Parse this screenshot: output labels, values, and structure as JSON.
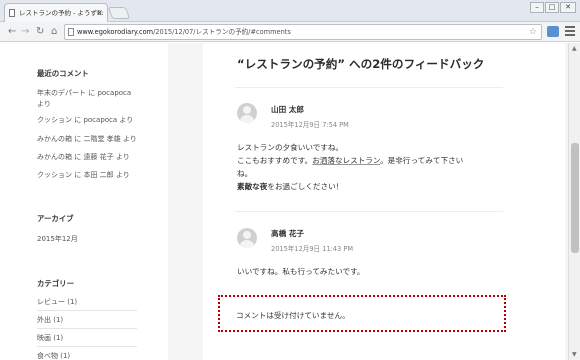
{
  "browser": {
    "tab_title": "レストランの予約 - ようずB:",
    "tab_close": "×",
    "url_domain": "www.egokorodiary.com",
    "url_path": "/2015/12/07/レストランの予約/#comments",
    "window_buttons": [
      "–",
      "□",
      "✕"
    ]
  },
  "sidebar": {
    "recent_comments_title": "最近のコメント",
    "recent_comments": [
      {
        "post": "年末のデパート",
        "sep": " に ",
        "author": "pocapoca",
        "suffix": "",
        "line2": "より"
      },
      {
        "post": "クッション",
        "sep": " に ",
        "author": "pocapoca",
        "suffix": " より"
      },
      {
        "post": "みかんの箱",
        "sep": " に ",
        "author": "二階堂 孝雄",
        "suffix": " より"
      },
      {
        "post": "みかんの箱",
        "sep": " に ",
        "author": "遠藤 花子",
        "suffix": " より"
      },
      {
        "post": "クッション",
        "sep": " に ",
        "author": "本田 二郎",
        "suffix": " より"
      }
    ],
    "archives_title": "アーカイブ",
    "archives": [
      "2015年12月"
    ],
    "categories_title": "カテゴリー",
    "categories": [
      "レビュー (1)",
      "外出 (1)",
      "映画 (1)",
      "食べ物 (1)"
    ]
  },
  "main": {
    "comments_title": "“レストランの予約” への2件のフィードバック",
    "comments": [
      {
        "author": "山田 太郎",
        "date": "2015年12月9日 7:54 PM",
        "line1": "レストランの夕食いいですね。",
        "line2_pre": "ここもおすすめです。",
        "line2_link": "お洒落なレストラン",
        "line2_post": "。是非行ってみて下さい",
        "line3": "ね。",
        "line4_bold": "素敵な夜",
        "line4_rest": "をお過ごしください！"
      },
      {
        "author": "高橋 花子",
        "date": "2015年12月9日 11:43 PM",
        "line1": "いいですね。私も行ってみたいです。"
      }
    ],
    "closed_notice": "コメントは受け付けていません。"
  },
  "colors": {
    "highlight_border": "#b20000",
    "accent": "#333333"
  }
}
